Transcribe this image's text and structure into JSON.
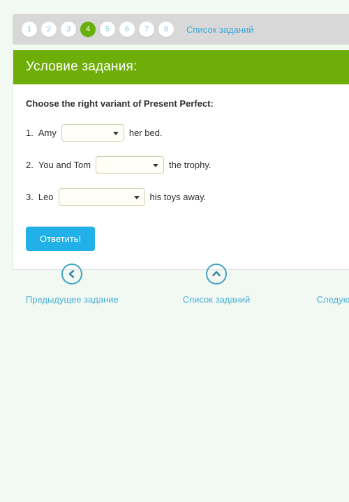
{
  "pagination": {
    "items": [
      {
        "label": "1",
        "active": false
      },
      {
        "label": "2",
        "active": false
      },
      {
        "label": "3",
        "active": false
      },
      {
        "label": "4",
        "active": true
      },
      {
        "label": "5",
        "active": false
      },
      {
        "label": "6",
        "active": false
      },
      {
        "label": "7",
        "active": false
      },
      {
        "label": "8",
        "active": false
      }
    ],
    "link_label": "Список заданий"
  },
  "card": {
    "header_title": "Условие задания:",
    "prompt": "Choose the right variant of Present Perfect:",
    "questions": [
      {
        "number": "1.",
        "before": "Amy",
        "value": "",
        "after": "her bed."
      },
      {
        "number": "2.",
        "before": "You and Tom",
        "value": "",
        "after": "the trophy."
      },
      {
        "number": "3.",
        "before": "Leo",
        "value": "",
        "after": "his toys away."
      }
    ],
    "submit_label": "Ответить!"
  },
  "bottom_nav": [
    {
      "label": "Предыдущее задание",
      "icon": "chevron-left-circle-icon"
    },
    {
      "label": "Список заданий",
      "icon": "chevron-up-circle-icon"
    },
    {
      "label": "Следующее задание",
      "icon": "chevron-right-circle-icon"
    }
  ],
  "colors": {
    "page_background": "#f2f8f2",
    "pager_bar": "#d8d8d8",
    "active_circle": "#66b007",
    "header_green": "#6fae09",
    "link_blue": "#3fa9d8",
    "button_blue": "#22b0e8",
    "select_fill": "#fffef7",
    "select_border": "#cfcfae"
  }
}
